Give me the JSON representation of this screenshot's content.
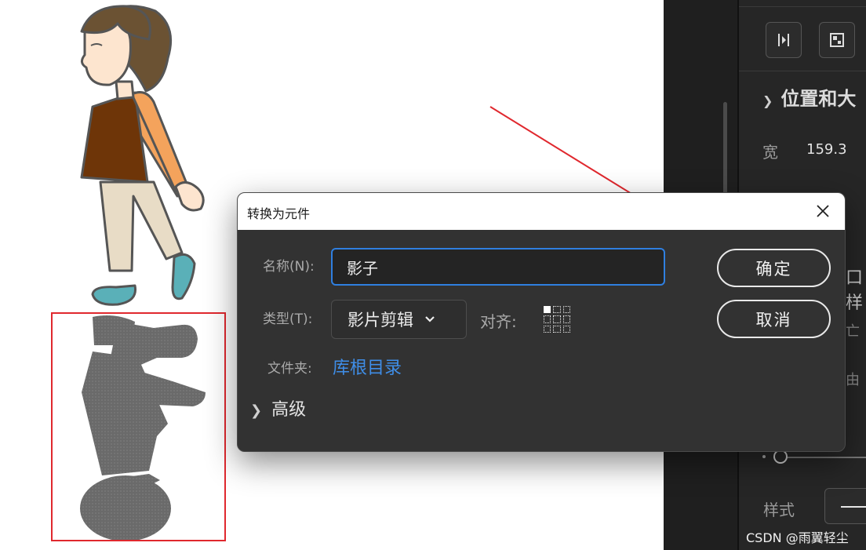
{
  "dialog": {
    "title": "转换为元件",
    "name_label": "名称(N):",
    "name_value": "影子",
    "type_label": "类型(T):",
    "type_value": "影片剪辑",
    "align_label": "对齐:",
    "folder_label": "文件夹:",
    "folder_value": "库根目录",
    "advanced_label": "高级",
    "ok_label": "确定",
    "cancel_label": "取消",
    "close_icon": "close-icon"
  },
  "panel": {
    "section_title": "位置和大",
    "width_label": "宽",
    "width_value": "159.3",
    "partial_label_1": "口样",
    "partial_label_2": "亡",
    "partial_label_3": "由",
    "style_label": "样式"
  },
  "watermark": "CSDN @雨翼轻尘",
  "colors": {
    "accent_blue": "#2f7fe0",
    "link_blue": "#3f8ee8",
    "annotation_red": "#e0282e",
    "dialog_bg": "#323232",
    "panel_bg": "#262626"
  }
}
